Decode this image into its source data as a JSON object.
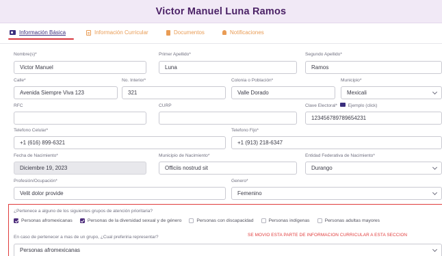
{
  "header": {
    "title": "Victor Manuel Luna Ramos"
  },
  "tabs": [
    {
      "label": "Información Básica",
      "icon": "id-card-icon",
      "active": true
    },
    {
      "label": "Información Curricular",
      "icon": "document-icon",
      "active": false
    },
    {
      "label": "Documentos",
      "icon": "file-icon",
      "active": false
    },
    {
      "label": "Notificaciones",
      "icon": "bell-icon",
      "active": false
    }
  ],
  "form": {
    "nombres": {
      "label": "Nombre(s)*",
      "value": "Victor Manuel"
    },
    "primer_apellido": {
      "label": "Primer Apellido*",
      "value": "Luna"
    },
    "segundo_apellido": {
      "label": "Segundo Apellido*",
      "value": "Ramos"
    },
    "calle": {
      "label": "Calle*",
      "value": "Avenida Siempre Viva 123"
    },
    "no_interior": {
      "label": "No. Interior*",
      "value": "321"
    },
    "colonia": {
      "label": "Colonia o Población*",
      "value": "Valle Dorado"
    },
    "municipio": {
      "label": "Municipio*",
      "value": "Mexicali"
    },
    "rfc": {
      "label": "RFC",
      "value": ""
    },
    "curp": {
      "label": "CURP",
      "value": ""
    },
    "clave_electoral": {
      "label": "Clave Electoral*",
      "example_link": "Ejemplo (click)",
      "value": "123456789789654231"
    },
    "telefono_celular": {
      "label": "Telefono Celular*",
      "value": "+1 (616) 899-6321"
    },
    "telefono_fijo": {
      "label": "Telefono Fijo*",
      "value": "+1 (913) 218-6347"
    },
    "fecha_nacimiento": {
      "label": "Fecha de Nacimiento*",
      "value": "Diciembre 19, 2023"
    },
    "municipio_nacimiento": {
      "label": "Municipio de Nacimiento*",
      "value": "Officiis nostrud sit"
    },
    "entidad_nacimiento": {
      "label": "Entidad Federativa de Nacimiento*",
      "value": "Durango"
    },
    "profesion": {
      "label": "Profesión/Ocupación*",
      "value": "Velit dolor provide"
    },
    "genero": {
      "label": "Genero*",
      "value": "Femenino"
    }
  },
  "priority": {
    "question": "¿Pertenece a alguno de los siguientes grupos de atención prioritaria?",
    "options": [
      {
        "label": "Personas afromexicanas",
        "checked": true
      },
      {
        "label": "Personas de la diversidad sexual y de género",
        "checked": true
      },
      {
        "label": "Personas con discapacidad",
        "checked": false
      },
      {
        "label": "Personas indígenas",
        "checked": false
      },
      {
        "label": "Personas adultas mayores",
        "checked": false
      }
    ],
    "represent_question": "En caso de pertenecer a mas de un grupo, ¿Cual preferiria representar?",
    "warning": "SE MOVIO ESTA PARTE DE INFORMACION CURRICULAR A ESTA SECCION",
    "represent_value": "Personas afromexicanas"
  },
  "colors": {
    "brand": "#4b2266",
    "accent": "#e99c55",
    "warning": "#e03a3a",
    "header_bg": "#f1e9f6"
  }
}
